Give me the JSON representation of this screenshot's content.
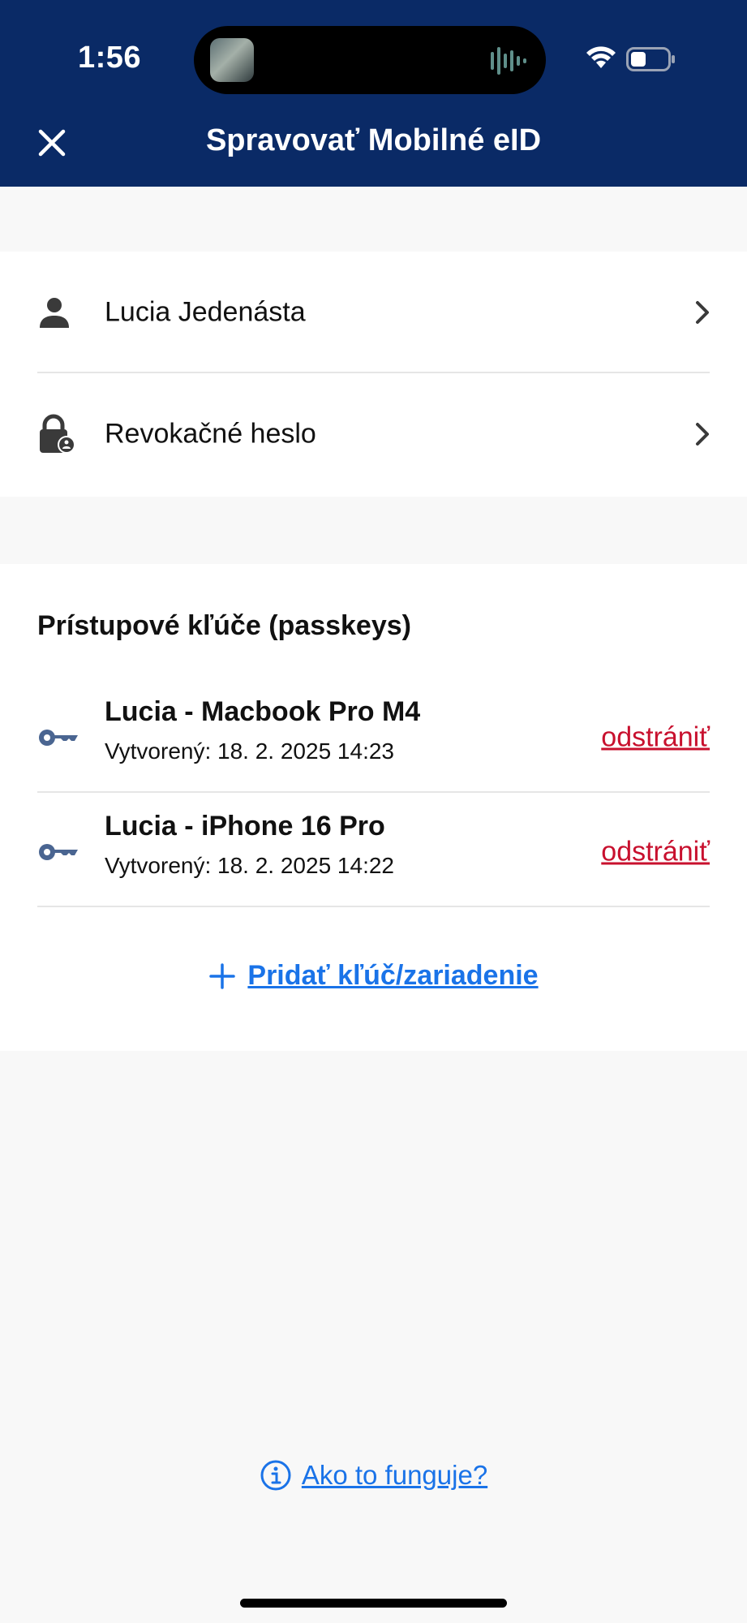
{
  "status_bar": {
    "time": "1:56"
  },
  "header": {
    "title": "Spravovať Mobilné eID",
    "close_icon": "close-icon"
  },
  "profile_menu": [
    {
      "label": "Lucia Jedenásta",
      "icon": "person-icon"
    },
    {
      "label": "Revokačné heslo",
      "icon": "lock-icon"
    }
  ],
  "passkeys": {
    "title": "Prístupové kľúče (passkeys)",
    "items": [
      {
        "name": "Lucia - Macbook Pro M4",
        "created": "Vytvorený: 18. 2. 2025 14:23",
        "remove_label": "odstrániť"
      },
      {
        "name": "Lucia - iPhone 16 Pro",
        "created": "Vytvorený: 18. 2. 2025 14:22",
        "remove_label": "odstrániť"
      }
    ],
    "add_label": "Pridať kľúč/zariadenie"
  },
  "help": {
    "label": "Ako to funguje?"
  },
  "colors": {
    "header_bg": "#0a2a66",
    "link_blue": "#1a73e8",
    "danger_red": "#c8102e",
    "key_icon": "#4a6591",
    "page_bg": "#f8f8f8"
  }
}
